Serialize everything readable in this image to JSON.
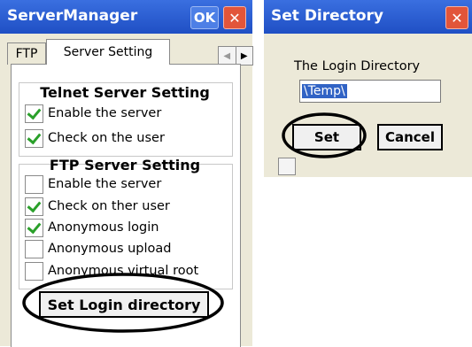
{
  "left": {
    "title": "ServerManager",
    "ok_label": "OK",
    "close_glyph": "✕",
    "tabs": [
      "FTP",
      "Server Setting"
    ],
    "scroll_left": "◀",
    "scroll_right": "▶",
    "telnet": {
      "title": "Telnet Server Setting",
      "items": [
        {
          "label": "Enable the server",
          "checked": true
        },
        {
          "label": "Check on the user",
          "checked": true
        }
      ]
    },
    "ftp": {
      "title": "FTP Server Setting",
      "items": [
        {
          "label": "Enable the server",
          "checked": false
        },
        {
          "label": "Check on ther user",
          "checked": true
        },
        {
          "label": "Anonymous login",
          "checked": true
        },
        {
          "label": "Anonymous upload",
          "checked": false
        },
        {
          "label": "Anonymous virtual root",
          "checked": false
        }
      ]
    },
    "login_button": "Set Login directory"
  },
  "dialog": {
    "title": "Set Directory",
    "close_glyph": "✕",
    "label": "The Login Directory",
    "input_value": "\\Temp\\",
    "set_label": "Set",
    "cancel_label": "Cancel"
  },
  "colors": {
    "titlebar": "#1f4fc4",
    "window_bg": "#ece9d8",
    "close_red": "#e2553a",
    "check_green": "#2aa02a",
    "highlight_ellipse": "#000000"
  }
}
